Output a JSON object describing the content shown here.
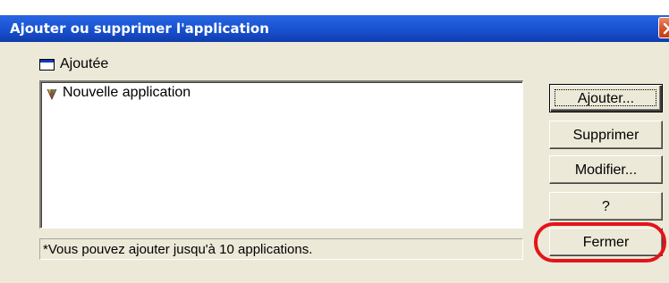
{
  "window": {
    "title": "Ajouter ou supprimer l'application",
    "close_icon": "close-icon"
  },
  "group": {
    "icon": "window-icon",
    "label": "Ajoutée"
  },
  "list": {
    "items": [
      {
        "label": "Nouvelle application",
        "icon": "application-icon"
      }
    ]
  },
  "footnote": "*Vous pouvez ajouter jusqu'à 10 applications.",
  "buttons": {
    "add": "Ajouter...",
    "delete": "Supprimer",
    "modify": "Modifier...",
    "help": "?",
    "close": "Fermer"
  },
  "colors": {
    "titlebar": "#1b57d6",
    "dialog_background": "#ece9d8",
    "highlight_ring": "#e4141a"
  }
}
